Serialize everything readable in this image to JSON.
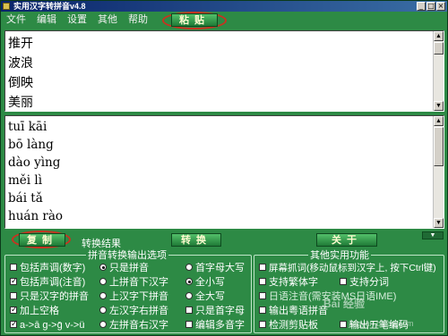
{
  "window": {
    "title": "实用汉字转拼音v4.8"
  },
  "menu": [
    "文件",
    "编辑",
    "设置",
    "其他",
    "帮助"
  ],
  "buttons": {
    "paste": "粘贴",
    "copy": "复制",
    "convert": "转换",
    "about": "关于"
  },
  "hanzi_lines": [
    "推开",
    "波浪",
    "倒映",
    "美丽"
  ],
  "pinyin_lines": [
    "tuī kāi",
    "bō làng",
    "dào yìng",
    "měi lì",
    "bái tǎ",
    "huán rào"
  ],
  "result_label": "转换结果",
  "pinyin_group": {
    "title": "拼音转换输出选项",
    "col1": [
      {
        "label": "包括声调(数字)",
        "checked": false
      },
      {
        "label": "包括声调(注音)",
        "checked": true
      },
      {
        "label": "只是汉字的拼音",
        "checked": false
      },
      {
        "label": "加上空格",
        "checked": true
      },
      {
        "label": "a->ā g->ḡ v->ü",
        "checked": true
      }
    ],
    "col2": [
      {
        "label": "只是拼音",
        "checked": true
      },
      {
        "label": "上拼音下汉字",
        "checked": false
      },
      {
        "label": "上汉字下拼音",
        "checked": false
      },
      {
        "label": "左汉字右拼音",
        "checked": false
      },
      {
        "label": "左拼音右汉字",
        "checked": false
      }
    ],
    "col3": [
      {
        "label": "首字母大写",
        "checked": false,
        "kind": "radio"
      },
      {
        "label": "全小写",
        "checked": true,
        "kind": "radio"
      },
      {
        "label": "全大写",
        "checked": false,
        "kind": "radio"
      },
      {
        "label": "只是首字母",
        "checked": false,
        "kind": "check"
      },
      {
        "label": "编辑多音字",
        "checked": false,
        "kind": "check"
      }
    ]
  },
  "utility_group": {
    "title": "其他实用功能",
    "items": [
      {
        "label": "屏幕抓词(移动鼠标到汉字上, 按下Ctrl键)",
        "checked": false
      },
      {
        "label": "支持繁体字",
        "checked": false
      },
      {
        "label": "支持分词",
        "checked": false
      },
      {
        "label": "日语注音(需安装MS日语IME)",
        "checked": false
      },
      {
        "label": "输出粤语拼音",
        "checked": false
      },
      {
        "label": "检测剪贴板",
        "checked": false
      },
      {
        "label": "输出五笔编码",
        "checked": false
      }
    ]
  },
  "watermark": {
    "text": "Bai 经验",
    "url": "jingyan.baidu.com"
  }
}
